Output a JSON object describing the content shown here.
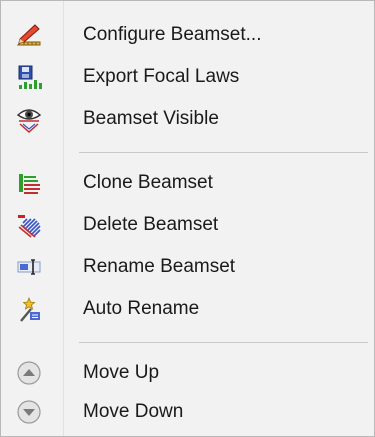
{
  "menu": {
    "items": [
      {
        "label": "Configure Beamset...",
        "icon": "configure-ruler-pencil-icon"
      },
      {
        "label": "Export Focal Laws",
        "icon": "save-disk-bars-icon"
      },
      {
        "label": "Beamset Visible",
        "icon": "eye-visible-icon"
      },
      {
        "label": "Clone Beamset",
        "icon": "clone-lines-icon"
      },
      {
        "label": "Delete Beamset",
        "icon": "delete-hatched-icon"
      },
      {
        "label": "Rename Beamset",
        "icon": "rename-textfield-icon"
      },
      {
        "label": "Auto Rename",
        "icon": "magic-wand-icon"
      },
      {
        "label": "Move Up",
        "icon": "arrow-up-circle-icon"
      },
      {
        "label": "Move Down",
        "icon": "arrow-down-circle-icon"
      }
    ]
  }
}
